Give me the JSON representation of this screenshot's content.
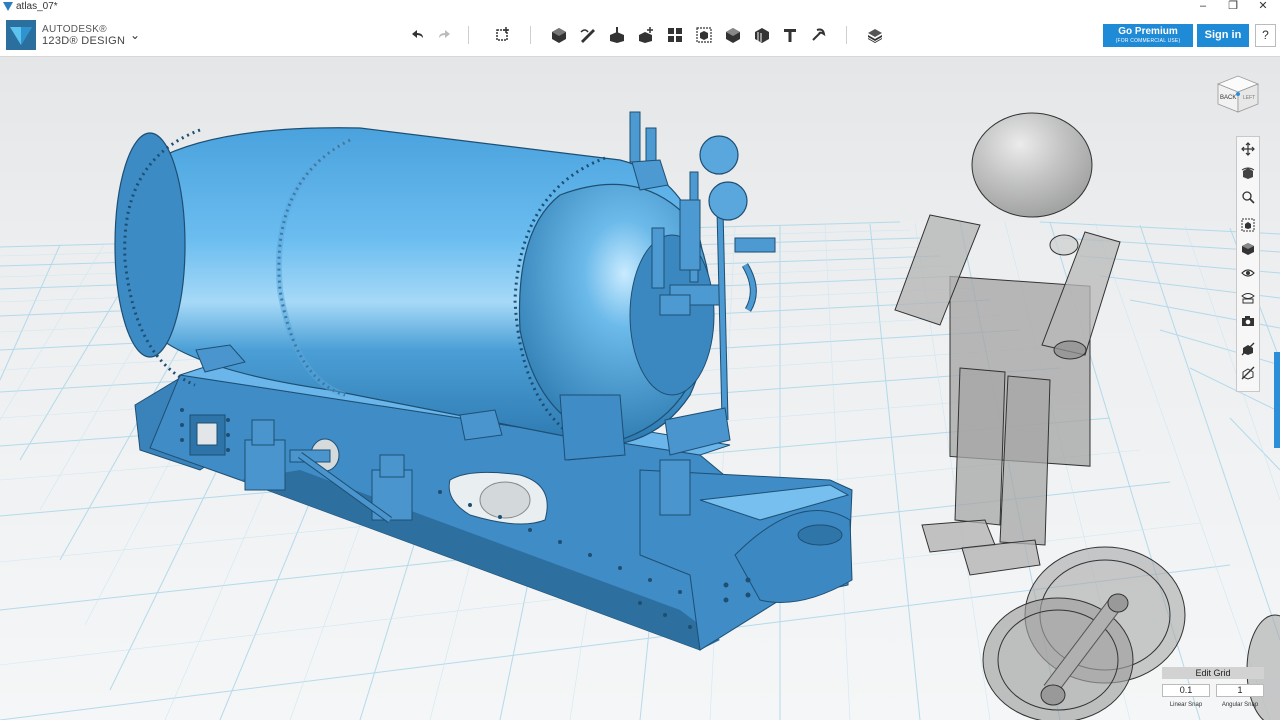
{
  "window": {
    "title": "atlas_07*",
    "minimize": "–",
    "maximize": "❐",
    "close": "✕"
  },
  "brand": {
    "line1": "AUTODESK®",
    "line2": "123D® DESIGN",
    "menu_icon": "chevron-down-icon"
  },
  "toolbar": {
    "tools": [
      "undo-icon",
      "redo-icon",
      "transform-icon",
      "primitives-icon",
      "sketch-icon",
      "construct-icon",
      "modify-icon",
      "pattern-icon",
      "group-icon",
      "combine-icon",
      "measure-icon",
      "text-icon",
      "snap-icon",
      "material-icon"
    ]
  },
  "account": {
    "premium_label": "Go Premium",
    "premium_sub": "(FOR COMMERCIAL USE)",
    "signin_label": "Sign in",
    "help_label": "?"
  },
  "viewcube": {
    "face_back": "BACK",
    "face_left": "LEFT"
  },
  "nav": {
    "tools": [
      "pan-icon",
      "orbit-icon",
      "zoom-icon",
      "fit-icon",
      "view-icon",
      "visibility-icon",
      "material-view-icon",
      "camera-icon",
      "hide-icon",
      "xray-icon"
    ]
  },
  "edit_grid": {
    "title": "Edit Grid",
    "linear_value": "0.1",
    "angular_value": "1",
    "linear_label": "Linear Snap",
    "angular_label": "Angular Snap"
  },
  "colors": {
    "accent": "#1f8ad6",
    "model": "#5aaee6",
    "grid": "#9fcfe6",
    "ghost": "#a8a8a8"
  }
}
